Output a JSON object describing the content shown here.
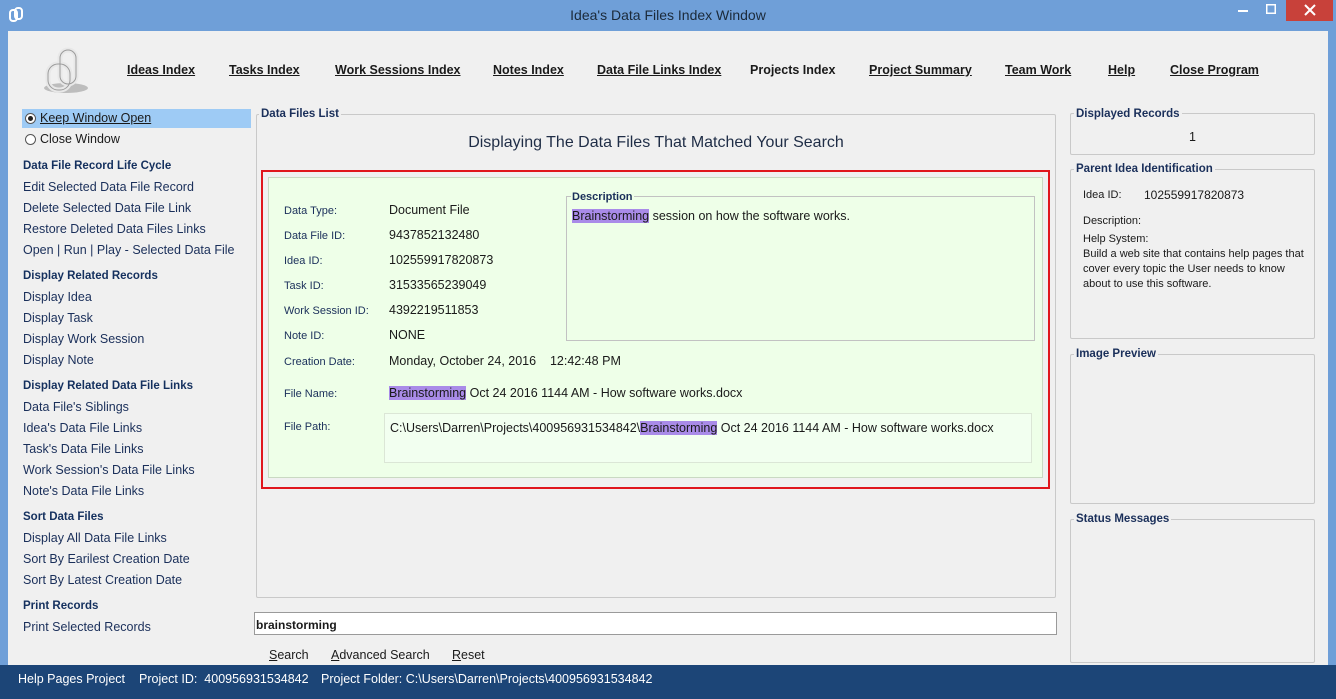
{
  "window": {
    "title": "Idea's Data Files Index Window"
  },
  "nav": [
    {
      "label": "Ideas Index"
    },
    {
      "label": "Tasks Index"
    },
    {
      "label": "Work Sessions Index"
    },
    {
      "label": "Notes Index"
    },
    {
      "label": "Data File Links Index"
    },
    {
      "label": "Projects Index"
    },
    {
      "label": "Project Summary"
    },
    {
      "label": "Team Work"
    },
    {
      "label": "Help"
    },
    {
      "label": "Close Program"
    }
  ],
  "sidebar": {
    "radio_keep": "Keep Window Open",
    "radio_close": "Close Window",
    "lifecycle_header": "Data File Record Life Cycle",
    "edit": "Edit Selected Data File Record",
    "delete": "Delete Selected Data File Link",
    "restore": "Restore Deleted Data Files Links",
    "open": "Open | Run | Play - Selected Data File",
    "related_header": "Display Related Records",
    "display_idea": "Display Idea",
    "display_task": "Display Task",
    "display_work_session": "Display Work Session",
    "display_note": "Display Note",
    "links_header": "Display Related Data File Links",
    "siblings": "Data File's Siblings",
    "idea_links": "Idea's Data File Links",
    "task_links": "Task's Data File Links",
    "work_session_links": "Work Session's Data File Links",
    "note_links": "Note's Data File Links",
    "sort_header": "Sort Data Files",
    "display_all": "Display All Data File Links",
    "sort_earliest": "Sort By Earilest Creation Date",
    "sort_latest": "Sort By Latest Creation Date",
    "print_header": "Print Records",
    "print_selected": "Print Selected Records"
  },
  "list": {
    "group_title": "Data Files List",
    "heading": "Displaying The Data Files That Matched Your Search"
  },
  "record": {
    "data_type_label": "Data Type:",
    "data_type": "Document File",
    "data_file_id_label": "Data File ID:",
    "data_file_id": "9437852132480",
    "idea_id_label": "Idea ID:",
    "idea_id": "102559917820873",
    "task_id_label": "Task ID:",
    "task_id": "31533565239049",
    "work_session_id_label": "Work Session ID:",
    "work_session_id": "4392219511853",
    "note_id_label": "Note ID:",
    "note_id": "NONE",
    "creation_date_label": "Creation Date:",
    "creation_date": "Monday, October 24, 2016    12:42:48 PM",
    "file_name_label": "File Name:",
    "file_name_highlight": "Brainstorming",
    "file_name_rest": " Oct 24 2016 1144 AM - How software works.docx",
    "file_path_label": "File Path:",
    "file_path_prefix": "C:\\Users\\Darren\\Projects\\400956931534842\\",
    "file_path_highlight": "Brainstorming",
    "file_path_rest": " Oct 24 2016 1144 AM - How software works.docx",
    "description_title": "Description",
    "description_highlight": "Brainstorming",
    "description_rest": " session on how the software works."
  },
  "search": {
    "value": "brainstorming",
    "search_u": "S",
    "search_rest": "earch",
    "advanced_u": "A",
    "advanced_rest": "dvanced Search",
    "reset_u": "R",
    "reset_rest": "eset"
  },
  "right": {
    "displayed_title": "Displayed Records",
    "displayed_count": "1",
    "parent_title": "Parent Idea Identification",
    "idea_id_label": "Idea ID:",
    "idea_id": "102559917820873",
    "description_label": "Description:",
    "description_text": "Help System:\nBuild a web site that contains help pages that cover every topic the User needs to know about to use this software.",
    "image_preview_title": "Image Preview",
    "status_title": "Status Messages"
  },
  "statusbar": {
    "project": "Help Pages Project",
    "project_id": "Project ID:  400956931534842",
    "project_folder": "Project Folder: C:\\Users\\Darren\\Projects\\400956931534842"
  },
  "colors": {
    "title_bar": "#6f9fd8",
    "status_bar": "#1c4577",
    "record_bg": "#eeffe8",
    "selection_box": "#e0161d",
    "highlight": "#a98be8",
    "radio_selected_bg": "#9ecbf5"
  },
  "icons": [
    "app-icon",
    "minimize-icon",
    "maximize-icon",
    "close-icon",
    "paperclip-logo"
  ]
}
